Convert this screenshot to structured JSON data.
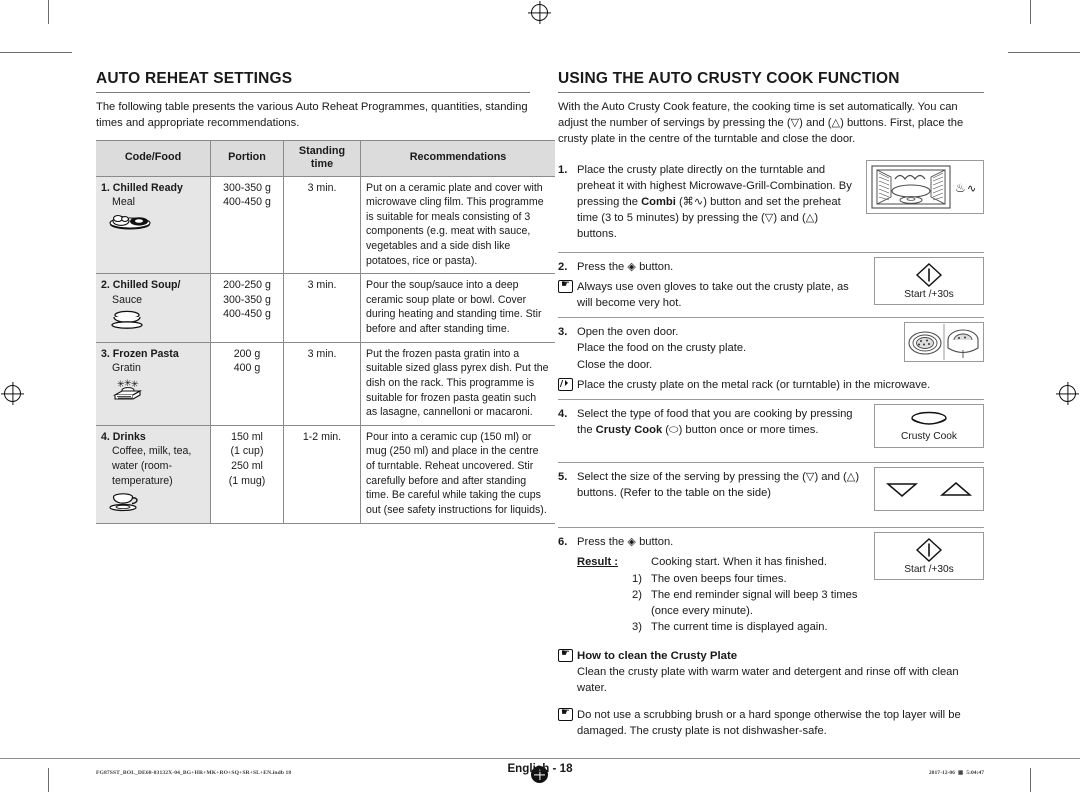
{
  "left": {
    "title": "AUTO REHEAT SETTINGS",
    "intro": "The following table presents the various Auto Reheat Programmes, quantities, standing times and appropriate recommendations.",
    "table": {
      "headers": [
        "Code/Food",
        "Portion",
        "Standing time",
        "Recommendations"
      ],
      "rows": [
        {
          "code": "1. Chilled Ready",
          "code_sub": "Meal",
          "icon": "plate-of-food-icon",
          "portion": "300-350 g\n400-450 g",
          "standing": "3 min.",
          "recommendation": "Put on a ceramic plate and cover with microwave cling film. This programme is suitable for meals consisting of 3 components (e.g. meat with sauce, vegetables and a side dish like potatoes, rice or pasta)."
        },
        {
          "code": "2. Chilled Soup/",
          "code_sub": "Sauce",
          "icon": "soup-bowl-icon",
          "portion": "200-250 g\n300-350 g\n400-450 g",
          "standing": "3 min.",
          "recommendation": "Pour the soup/sauce into a deep ceramic soup plate or bowl. Cover during heating and standing time. Stir before and after standing time."
        },
        {
          "code": "3. Frozen Pasta",
          "code_sub": "Gratin",
          "icon": "frozen-gratin-dish-icon",
          "portion": "200 g\n400 g",
          "standing": "3 min.",
          "recommendation": "Put the frozen pasta gratin into a suitable sized glass pyrex dish. Put the dish on the rack. This programme is suitable for frozen pasta geatin such as lasagne, cannelloni or macaroni."
        },
        {
          "code": "4. Drinks",
          "code_sub": "Coffee, milk, tea, water (room-temperature)",
          "icon": "coffee-cup-icon",
          "portion": "150 ml\n(1 cup)\n250 ml\n(1 mug)",
          "standing": "1-2 min.",
          "recommendation": "Pour into a ceramic cup (150 ml) or mug (250 ml) and place in the centre of turntable. Reheat uncovered. Stir carefully before and after standing time. Be careful while taking the cups out (see safety instructions for liquids)."
        }
      ]
    }
  },
  "right": {
    "title": "USING THE AUTO CRUSTY COOK FUNCTION",
    "intro": "With the Auto Crusty Cook feature, the cooking time is set automatically. You can adjust the number of servings by pressing the (▽) and (△) buttons. First, place the crusty plate in the centre of the turntable and close the door.",
    "steps": [
      {
        "num": "1.",
        "text_a": "Place the crusty plate directly on the turntable and preheat it with highest Microwave-Grill-Combination. By pressing the ",
        "bold": "Combi",
        "text_b": " (⌘∿) button and set the preheat time (3 to 5 minutes) by pressing the (▽) and (△) buttons.",
        "illustration": "microwave-oven-combi-icon"
      },
      {
        "num": "2.",
        "text_a": "Press the ◈ button.",
        "note": "Always use oven gloves to take out the crusty plate, as will become very hot.",
        "note_icon": "hand-pointer-icon",
        "illustration": "start-plus-30s-button",
        "illustration_caption": "Start /+30s"
      },
      {
        "num": "3.",
        "lines": [
          "Open the oven door.",
          "Place the food on the crusty plate.",
          "Close the door."
        ],
        "note": "Place the crusty plate on the metal rack (or turntable) in the microwave.",
        "note_icon": "pencil-note-icon",
        "illustration": "crusty-plate-with-food-icon"
      },
      {
        "num": "4.",
        "text_a": "Select the type of food that you are cooking by pressing the ",
        "bold": "Crusty Cook",
        "text_b": " (⬭) button once or more times.",
        "illustration": "crusty-cook-button",
        "illustration_caption": "Crusty Cook"
      },
      {
        "num": "5.",
        "text_a": "Select the size of the serving by pressing the (▽) and (△) buttons. (Refer to the table on the side)",
        "illustration": "up-down-arrow-buttons"
      },
      {
        "num": "6.",
        "text_a": "Press the ◈ button.",
        "illustration": "start-plus-30s-button",
        "illustration_caption": "Start /+30s"
      }
    ],
    "result": {
      "label": "Result :",
      "main": "Cooking start. When it has finished.",
      "items": [
        {
          "marker": "1)",
          "text": "The oven beeps four times."
        },
        {
          "marker": "2)",
          "text": "The end reminder signal will beep 3 times (once every minute)."
        },
        {
          "marker": "3)",
          "text": "The current time is displayed again."
        }
      ]
    },
    "clean": {
      "icon": "hand-pointer-icon",
      "title": "How to clean the Crusty Plate",
      "text": "Clean the crusty plate with warm water and detergent and rinse off with clean water."
    },
    "warning": {
      "icon": "hand-pointer-icon",
      "text": "Do not use a scrubbing brush or a hard sponge otherwise the top layer will be damaged. The crusty plate is not dishwasher-safe."
    }
  },
  "footer": {
    "page_label": "English - 18",
    "print_file": "FG87SST_BOL_DE68-03132X-04_BG+HR+MK+RO+SQ+SR+SL+EN.indb   18",
    "print_date": "2017-12-06",
    "print_time": "5:04:47"
  }
}
